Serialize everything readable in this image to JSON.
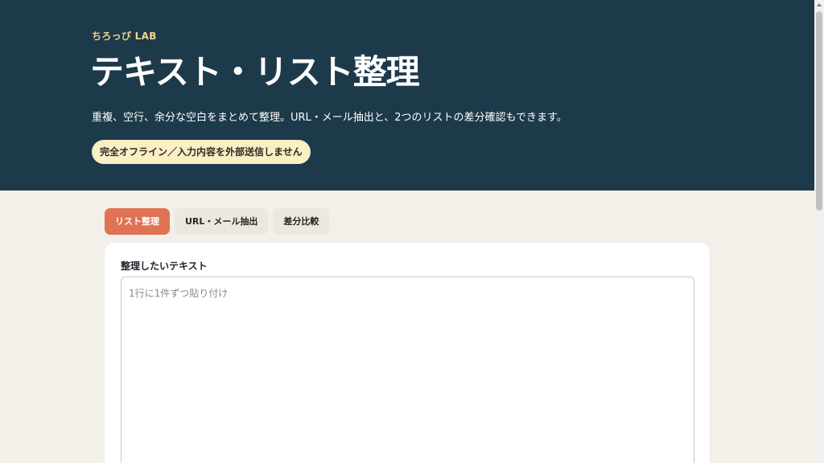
{
  "hero": {
    "brand": "ちろっぴ LAB",
    "title": "テキスト・リスト整理",
    "subtitle": "重複、空行、余分な空白をまとめて整理。URL・メール抽出と、2つのリストの差分確認もできます。",
    "badge": "完全オフライン／入力内容を外部送信しません"
  },
  "tabs": [
    {
      "label": "リスト整理",
      "active": true
    },
    {
      "label": "URL・メール抽出",
      "active": false
    },
    {
      "label": "差分比較",
      "active": false
    }
  ],
  "editor": {
    "label": "整理したいテキスト",
    "value": "",
    "placeholder": "1行に1件ずつ貼り付け"
  },
  "colors": {
    "hero_bg": "#1c3a4a",
    "accent": "#e07354",
    "brand": "#f2d38a",
    "badge_bg": "#fbefc4",
    "page_bg": "#f3f0e9"
  }
}
